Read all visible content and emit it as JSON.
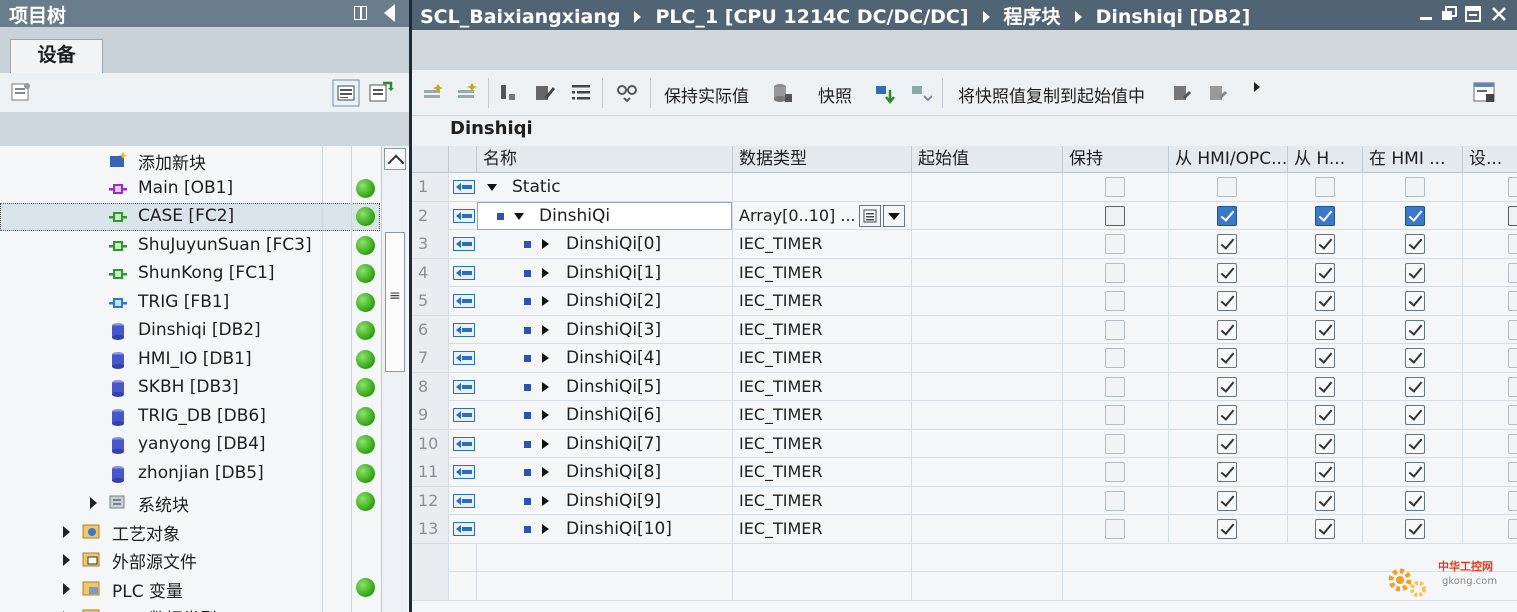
{
  "project_tree": {
    "title": "项目树",
    "tab": "设备",
    "items": [
      {
        "label": "添加新块",
        "icon": "add-block-icon",
        "indent": 1,
        "status": false,
        "expander": false
      },
      {
        "label": "Main [OB1]",
        "icon": "ob-block-icon",
        "indent": 1,
        "status": true,
        "expander": false
      },
      {
        "label": "CASE [FC2]",
        "icon": "fc-block-icon",
        "indent": 1,
        "status": true,
        "expander": false,
        "selected": true
      },
      {
        "label": "ShuJuyunSuan [FC3]",
        "icon": "fc-block-icon",
        "indent": 1,
        "status": true,
        "expander": false
      },
      {
        "label": "ShunKong [FC1]",
        "icon": "fc-block-icon",
        "indent": 1,
        "status": true,
        "expander": false
      },
      {
        "label": "TRIG [FB1]",
        "icon": "fb-block-icon",
        "indent": 1,
        "status": true,
        "expander": false
      },
      {
        "label": "Dinshiqi [DB2]",
        "icon": "db-block-icon",
        "indent": 1,
        "status": true,
        "expander": false
      },
      {
        "label": "HMI_IO [DB1]",
        "icon": "db-block-icon",
        "indent": 1,
        "status": true,
        "expander": false
      },
      {
        "label": "SKBH [DB3]",
        "icon": "db-block-icon",
        "indent": 1,
        "status": true,
        "expander": false
      },
      {
        "label": "TRIG_DB [DB6]",
        "icon": "db-block-icon",
        "indent": 1,
        "status": true,
        "expander": false
      },
      {
        "label": "yanyong [DB4]",
        "icon": "db-block-icon",
        "indent": 1,
        "status": true,
        "expander": false
      },
      {
        "label": "zhonjian [DB5]",
        "icon": "db-block-icon",
        "indent": 1,
        "status": true,
        "expander": false
      },
      {
        "label": "系统块",
        "icon": "system-block-icon",
        "indent": 0,
        "status": true,
        "expander": true
      },
      {
        "label": "工艺对象",
        "icon": "technology-object-icon",
        "indent": -1,
        "status": false,
        "expander": true
      },
      {
        "label": "外部源文件",
        "icon": "external-source-icon",
        "indent": -1,
        "status": false,
        "expander": true
      },
      {
        "label": "PLC 变量",
        "icon": "plc-tags-icon",
        "indent": -1,
        "status": true,
        "expander": true
      },
      {
        "label": "PLC 数据类型",
        "icon": "plc-datatype-icon",
        "indent": -1,
        "status": false,
        "expander": true
      }
    ]
  },
  "breadcrumb": [
    "SCL_Baixiangxiang",
    "PLC_1 [CPU 1214C DC/DC/DC]",
    "程序块",
    "Dinshiqi [DB2]"
  ],
  "toolbar": {
    "keep_actual": "保持实际值",
    "snapshot": "快照",
    "copy_snapshot": "将快照值复制到起始值中"
  },
  "block_name": "Dinshiqi",
  "table": {
    "headers": [
      "名称",
      "数据类型",
      "起始值",
      "保持",
      "从 HMI/OPC...",
      "从 H...",
      "在 HMI ...",
      "设..."
    ],
    "rows": [
      {
        "num": "1",
        "name": "Static",
        "type": "",
        "level": 0,
        "expanded": true,
        "bullet": false,
        "checks": [
          false,
          false,
          false,
          false
        ]
      },
      {
        "num": "2",
        "name": "DinshiQi",
        "type": "Array[0..10] ...",
        "level": 1,
        "expanded": true,
        "bullet": true,
        "editing": true,
        "checks": [
          false,
          true,
          true,
          true
        ]
      },
      {
        "num": "3",
        "name": "DinshiQi[0]",
        "type": "IEC_TIMER",
        "level": 2,
        "expanded": false,
        "bullet": true,
        "checks": [
          false,
          true,
          true,
          true
        ]
      },
      {
        "num": "4",
        "name": "DinshiQi[1]",
        "type": "IEC_TIMER",
        "level": 2,
        "expanded": false,
        "bullet": true,
        "checks": [
          false,
          true,
          true,
          true
        ]
      },
      {
        "num": "5",
        "name": "DinshiQi[2]",
        "type": "IEC_TIMER",
        "level": 2,
        "expanded": false,
        "bullet": true,
        "checks": [
          false,
          true,
          true,
          true
        ]
      },
      {
        "num": "6",
        "name": "DinshiQi[3]",
        "type": "IEC_TIMER",
        "level": 2,
        "expanded": false,
        "bullet": true,
        "checks": [
          false,
          true,
          true,
          true
        ]
      },
      {
        "num": "7",
        "name": "DinshiQi[4]",
        "type": "IEC_TIMER",
        "level": 2,
        "expanded": false,
        "bullet": true,
        "checks": [
          false,
          true,
          true,
          true
        ]
      },
      {
        "num": "8",
        "name": "DinshiQi[5]",
        "type": "IEC_TIMER",
        "level": 2,
        "expanded": false,
        "bullet": true,
        "checks": [
          false,
          true,
          true,
          true
        ]
      },
      {
        "num": "9",
        "name": "DinshiQi[6]",
        "type": "IEC_TIMER",
        "level": 2,
        "expanded": false,
        "bullet": true,
        "checks": [
          false,
          true,
          true,
          true
        ]
      },
      {
        "num": "10",
        "name": "DinshiQi[7]",
        "type": "IEC_TIMER",
        "level": 2,
        "expanded": false,
        "bullet": true,
        "checks": [
          false,
          true,
          true,
          true
        ]
      },
      {
        "num": "11",
        "name": "DinshiQi[8]",
        "type": "IEC_TIMER",
        "level": 2,
        "expanded": false,
        "bullet": true,
        "checks": [
          false,
          true,
          true,
          true
        ]
      },
      {
        "num": "12",
        "name": "DinshiQi[9]",
        "type": "IEC_TIMER",
        "level": 2,
        "expanded": false,
        "bullet": true,
        "checks": [
          false,
          true,
          true,
          true
        ]
      },
      {
        "num": "13",
        "name": "DinshiQi[10]",
        "type": "IEC_TIMER",
        "level": 2,
        "expanded": false,
        "bullet": true,
        "checks": [
          false,
          true,
          true,
          true
        ]
      }
    ]
  },
  "watermark": {
    "name": "中华工控网",
    "url": "gkong.com"
  },
  "colors": {
    "titlebar": "#6a7d8a",
    "breadcrumb": "#506474",
    "status_ok": "#2fa012",
    "checkbox_selected": "#3a79c9"
  }
}
